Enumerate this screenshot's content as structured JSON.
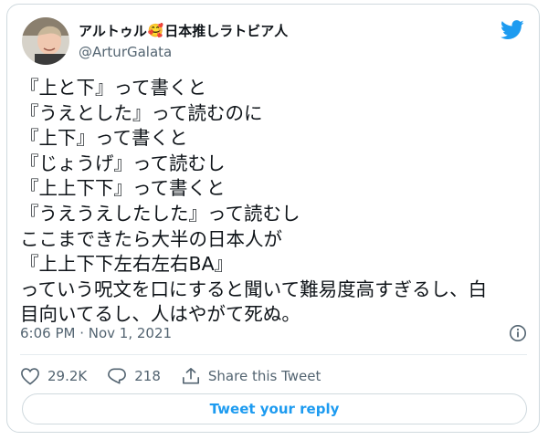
{
  "author": {
    "name_prefix": "アルトゥル",
    "name_emoji": "🥰",
    "name_suffix": "日本推しラトビア人",
    "handle": "@ArturGalata"
  },
  "tweet": {
    "lines": [
      "『上と下』って書くと",
      "『うえとした』って読むのに",
      "『上下』って書くと",
      "『じょうげ』って読むし",
      "『上上下下』って書くと",
      "『うえうえしたした』って読むし",
      "ここまできたら大半の日本人が",
      "『上上下下左右左右BA』",
      "っていう呪文を口にすると聞いて難易度高すぎるし、白",
      "目向いてるし、人はやがて死ぬ。"
    ],
    "timestamp": "6:06 PM · Nov 1, 2021"
  },
  "actions": {
    "like_count": "29.2K",
    "reply_count": "218",
    "share_label": "Share this Tweet"
  },
  "reply_button_label": "Tweet your reply",
  "colors": {
    "accent": "#1d9bf0",
    "muted": "#536471",
    "border": "#cfd9de"
  },
  "icons": [
    "twitter-bird-icon",
    "info-icon",
    "heart-icon",
    "reply-icon",
    "share-icon"
  ]
}
